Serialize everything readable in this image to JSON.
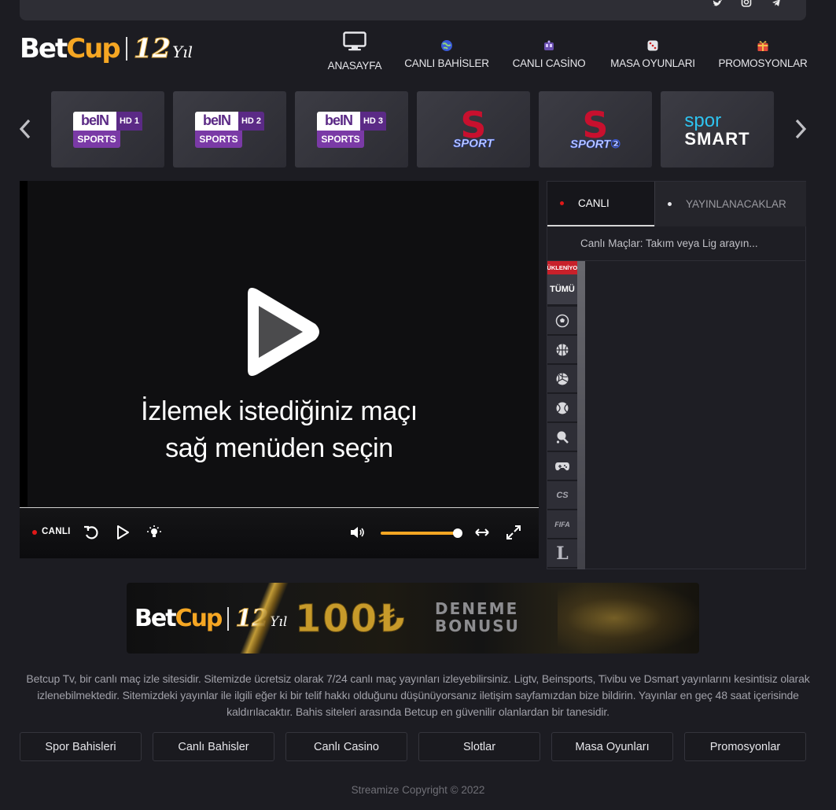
{
  "brand": {
    "logo_main": "Bet",
    "logo_accent": "Cup",
    "anniversary_number": "12",
    "anniversary_suffix": "Yıl"
  },
  "social": {
    "icons": [
      "twitter-icon",
      "instagram-icon",
      "telegram-icon"
    ]
  },
  "nav": [
    {
      "label": "ANASAYFA",
      "icon": "monitor-icon"
    },
    {
      "label": "CANLI BAHİSLER",
      "icon": "globe-icon"
    },
    {
      "label": "CANLI CASİNO",
      "icon": "casino-icon"
    },
    {
      "label": "MASA OYUNLARI",
      "icon": "dice-icon"
    },
    {
      "label": "PROMOSYONLAR",
      "icon": "gift-icon"
    }
  ],
  "channels": [
    {
      "brand": "bein",
      "hd": "HD 1",
      "sub": "SPORTS"
    },
    {
      "brand": "bein",
      "hd": "HD 2",
      "sub": "SPORTS"
    },
    {
      "brand": "bein",
      "hd": "HD 3",
      "sub": "SPORTS"
    },
    {
      "brand": "S",
      "word": "SPORT"
    },
    {
      "brand": "S",
      "word": "SPORT②"
    },
    {
      "brand": "sporsmart",
      "top": "spor",
      "bottom": "SMART"
    }
  ],
  "bein_word": "beIN",
  "player": {
    "message_line1": "İzlemek istediğiniz maçı",
    "message_line2": "sağ menüden seçin",
    "live_label": "CANLI",
    "volume_percent": 100
  },
  "panel": {
    "tab_live": "CANLI",
    "tab_upcoming": "YAYINLANACAKLAR",
    "search_placeholder": "Canlı Maçlar: Takım veya Lig arayın...",
    "loading_label": "YÜKLENİYOR",
    "all_label": "TÜMÜ",
    "categories": [
      "football-icon",
      "basketball-icon",
      "volleyball-icon",
      "tennis-icon",
      "table-tennis-icon",
      "gamepad-icon",
      "CS",
      "FIFA",
      "L"
    ]
  },
  "banner": {
    "amount": "100₺",
    "line1": "DENEME",
    "line2": "BONUSU"
  },
  "description": "Betcup Tv, bir canlı maç izle sitesidir. Sitemizde ücretsiz olarak 7/24 canlı maç yayınları izleyebilirsiniz. Ligtv, Beinsports, Tivibu ve Dsmart yayınlarını kesintisiz olarak izlenebilmektedir. Sitemizdeki yayınlar ile ilgili eğer ki bir telif hakkı olduğunu düşünüyorsanız iletişim sayfamızdan bize bildirin. Yayınlar en geç 48 saat içerisinde kaldırılacaktır. Bahis siteleri arasında Betcup en güvenilir olanlardan bir tanesidir.",
  "footer_links": [
    "Spor Bahisleri",
    "Canlı Bahisler",
    "Canlı Casino",
    "Slotlar",
    "Masa Oyunları",
    "Promosyonlar"
  ],
  "copyright": "Streamize Copyright © 2022",
  "colors": {
    "accent": "#f5a623",
    "live_red": "#e01818",
    "background": "#1c1c22"
  }
}
